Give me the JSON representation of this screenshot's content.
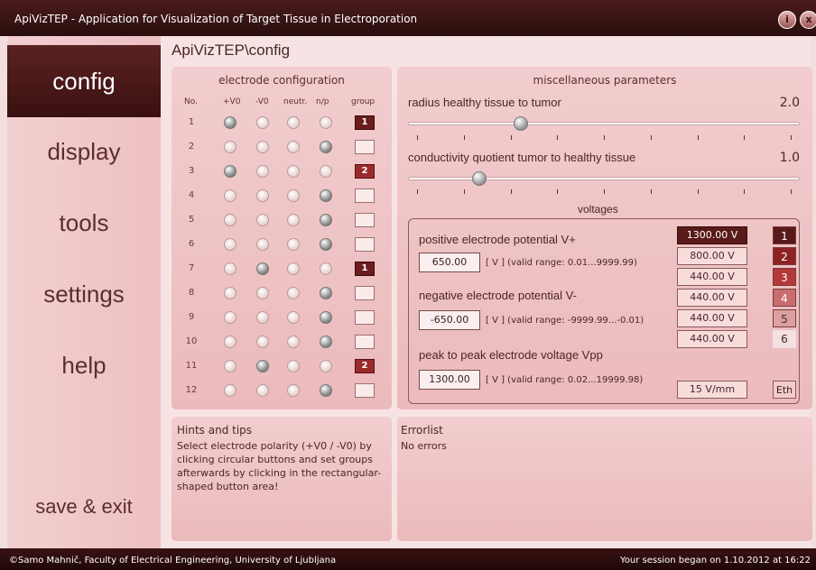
{
  "window": {
    "title": "ApiVizTEP - Application for Visualization of Target Tissue in Electroporation",
    "btn_info": "i",
    "btn_close": "x"
  },
  "sidebar": {
    "items": [
      {
        "label": "config",
        "active": true
      },
      {
        "label": "display"
      },
      {
        "label": "tools"
      },
      {
        "label": "settings"
      },
      {
        "label": "help"
      },
      {
        "label": "save & exit"
      }
    ]
  },
  "breadcrumb": "ApiVizTEP\\config",
  "electrode": {
    "title": "electrode configuration",
    "headers": [
      "No.",
      "+V0",
      "-V0",
      "neutr.",
      "n/p",
      "group"
    ],
    "rows": [
      {
        "no": "1",
        "state": "pos",
        "group": "1"
      },
      {
        "no": "2",
        "state": "np",
        "group": ""
      },
      {
        "no": "3",
        "state": "pos",
        "group": "2"
      },
      {
        "no": "4",
        "state": "np",
        "group": ""
      },
      {
        "no": "5",
        "state": "np",
        "group": ""
      },
      {
        "no": "6",
        "state": "np",
        "group": ""
      },
      {
        "no": "7",
        "state": "neg",
        "group": "1"
      },
      {
        "no": "8",
        "state": "np",
        "group": ""
      },
      {
        "no": "9",
        "state": "np",
        "group": ""
      },
      {
        "no": "10",
        "state": "np",
        "group": ""
      },
      {
        "no": "11",
        "state": "neg",
        "group": "2"
      },
      {
        "no": "12",
        "state": "np",
        "group": ""
      }
    ]
  },
  "misc": {
    "title": "miscellaneous parameters",
    "radius_label": "radius healthy tissue to tumor",
    "radius_value": "2.0",
    "radius_slider": 0.28,
    "cond_label": "conductivity quotient tumor to healthy tissue",
    "cond_value": "1.0",
    "cond_slider": 0.17
  },
  "voltages": {
    "title": "voltages",
    "pos_label": "positive electrode potential V+",
    "pos_value": "650.00",
    "pos_range": "[ V ]  (valid range: 0.01...9999.99)",
    "neg_label": "negative electrode potential V-",
    "neg_value": "-650.00",
    "neg_range": "[ V ]  (valid range: -9999.99...-0.01)",
    "vpp_label": "peak to peak electrode voltage Vpp",
    "vpp_value": "1300.00",
    "vpp_range": "[ V ]  (valid range: 0.02...19999.98)",
    "groups": [
      {
        "value": "1300.00 V",
        "num": "1"
      },
      {
        "value": "800.00 V",
        "num": "2"
      },
      {
        "value": "440.00 V",
        "num": "3"
      },
      {
        "value": "440.00 V",
        "num": "4"
      },
      {
        "value": "440.00 V",
        "num": "5"
      },
      {
        "value": "440.00 V",
        "num": "6"
      }
    ],
    "eth_value": "15 V/mm",
    "eth_label": "Eth",
    "colors": {
      "g1": "#5a1a1a",
      "g2": "#8e2323",
      "g3": "#b33838",
      "g4": "#c96d6d",
      "g5": "#dca0a0"
    }
  },
  "hints": {
    "title": "Hints and tips",
    "text": "Select electrode polarity (+V0 / -V0) by clicking circular buttons and set groups afterwards by clicking in the rectangular-shaped button area!"
  },
  "errors": {
    "title": "Errorlist",
    "text": "No errors"
  },
  "footer": {
    "left": "©Samo Mahnič, Faculty of Electrical Engineering, University of Ljubljana",
    "right": "Your session began on 1.10.2012 at 16:22"
  }
}
